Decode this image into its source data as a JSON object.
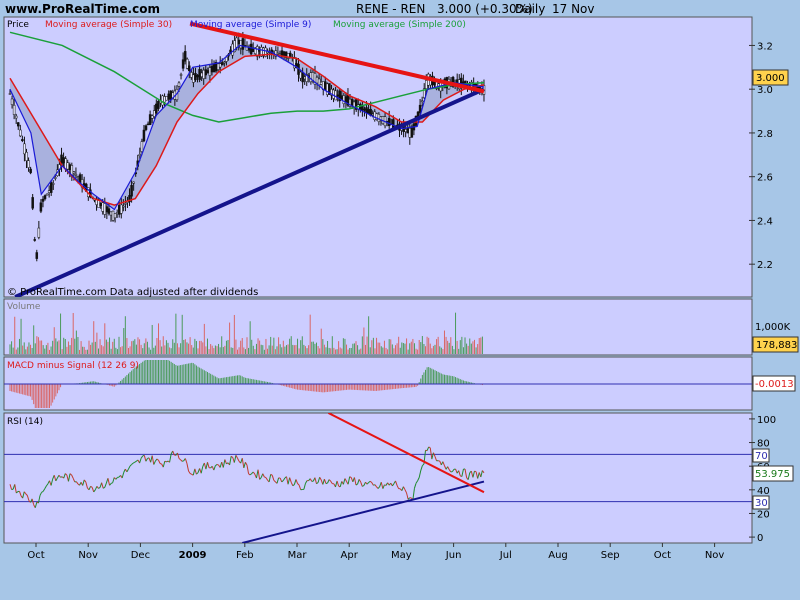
{
  "header": {
    "site": "www.ProRealTime.com",
    "symbol": "RENE - REN",
    "quote": "3.000 (+0.30%)",
    "period": "Daily",
    "date": "17 Nov"
  },
  "colors": {
    "panel_bg": "#cccdff",
    "page_bg": "#a7c6e7",
    "ma30": "#dd1a1a",
    "ma9": "#1a1ad6",
    "ma200": "#1aa03a",
    "uptrend": "#14148c",
    "downtrend": "#e61414"
  },
  "chart_data": [
    {
      "type": "candlestick",
      "panel": "Price",
      "legend": [
        {
          "label": "Price",
          "color": "#000000"
        },
        {
          "label": "Moving average (Simple 30)",
          "color": "#dd1a1a"
        },
        {
          "label": "Moving average (Simple 9)",
          "color": "#1a1ad6"
        },
        {
          "label": "Moving average (Simple 200)",
          "color": "#1aa03a"
        }
      ],
      "note": "© ProRealTime.com  Data adjusted after dividends",
      "last_value": "3.000",
      "ylim": [
        2.05,
        3.33
      ],
      "y_ticks": [
        "3.2",
        "3.0",
        "2.8",
        "2.6",
        "2.4",
        "2.2"
      ],
      "y_tick_values": [
        3.2,
        3.0,
        2.8,
        2.6,
        2.4,
        2.2
      ],
      "x_labels": [
        "Oct",
        "Nov",
        "Dec",
        "2009",
        "Feb",
        "Mar",
        "Apr",
        "May",
        "Jun",
        "Jul",
        "Aug",
        "Sep",
        "Oct",
        "Nov"
      ],
      "close": [
        {
          "t": 0,
          "v": 2.98
        },
        {
          "t": 0.2,
          "v": 2.8
        },
        {
          "t": 0.4,
          "v": 2.62
        },
        {
          "t": 0.5,
          "v": 2.2
        },
        {
          "t": 0.6,
          "v": 2.48
        },
        {
          "t": 0.8,
          "v": 2.55
        },
        {
          "t": 1.0,
          "v": 2.68
        },
        {
          "t": 1.3,
          "v": 2.6
        },
        {
          "t": 1.6,
          "v": 2.5
        },
        {
          "t": 2.0,
          "v": 2.42
        },
        {
          "t": 2.3,
          "v": 2.5
        },
        {
          "t": 2.6,
          "v": 2.82
        },
        {
          "t": 2.9,
          "v": 2.95
        },
        {
          "t": 3.2,
          "v": 2.98
        },
        {
          "t": 3.35,
          "v": 3.15
        },
        {
          "t": 3.5,
          "v": 3.05
        },
        {
          "t": 3.8,
          "v": 3.08
        },
        {
          "t": 4.1,
          "v": 3.12
        },
        {
          "t": 4.35,
          "v": 3.22
        },
        {
          "t": 4.6,
          "v": 3.18
        },
        {
          "t": 5.0,
          "v": 3.17
        },
        {
          "t": 5.4,
          "v": 3.15
        },
        {
          "t": 5.6,
          "v": 3.05
        },
        {
          "t": 5.8,
          "v": 3.06
        },
        {
          "t": 6.2,
          "v": 2.98
        },
        {
          "t": 6.6,
          "v": 2.93
        },
        {
          "t": 7.0,
          "v": 2.88
        },
        {
          "t": 7.4,
          "v": 2.83
        },
        {
          "t": 7.7,
          "v": 2.8
        },
        {
          "t": 7.85,
          "v": 2.9
        },
        {
          "t": 8.0,
          "v": 3.05
        },
        {
          "t": 8.2,
          "v": 3.02
        },
        {
          "t": 8.5,
          "v": 3.03
        },
        {
          "t": 8.8,
          "v": 3.02
        },
        {
          "t": 9.08,
          "v": 3.0
        }
      ],
      "ma30": [
        {
          "t": 0,
          "v": 3.05
        },
        {
          "t": 0.5,
          "v": 2.85
        },
        {
          "t": 1.0,
          "v": 2.65
        },
        {
          "t": 1.6,
          "v": 2.5
        },
        {
          "t": 2.0,
          "v": 2.47
        },
        {
          "t": 2.4,
          "v": 2.5
        },
        {
          "t": 2.8,
          "v": 2.65
        },
        {
          "t": 3.2,
          "v": 2.85
        },
        {
          "t": 3.6,
          "v": 2.98
        },
        {
          "t": 4.0,
          "v": 3.08
        },
        {
          "t": 4.5,
          "v": 3.15
        },
        {
          "t": 5.0,
          "v": 3.16
        },
        {
          "t": 5.5,
          "v": 3.14
        },
        {
          "t": 6.0,
          "v": 3.06
        },
        {
          "t": 6.5,
          "v": 2.97
        },
        {
          "t": 7.0,
          "v": 2.92
        },
        {
          "t": 7.5,
          "v": 2.85
        },
        {
          "t": 7.9,
          "v": 2.85
        },
        {
          "t": 8.3,
          "v": 2.95
        },
        {
          "t": 8.7,
          "v": 3.0
        },
        {
          "t": 9.08,
          "v": 3.02
        }
      ],
      "ma9": [
        {
          "t": 0,
          "v": 3.0
        },
        {
          "t": 0.4,
          "v": 2.8
        },
        {
          "t": 0.6,
          "v": 2.52
        },
        {
          "t": 1.0,
          "v": 2.65
        },
        {
          "t": 1.3,
          "v": 2.58
        },
        {
          "t": 1.6,
          "v": 2.52
        },
        {
          "t": 2.0,
          "v": 2.45
        },
        {
          "t": 2.4,
          "v": 2.62
        },
        {
          "t": 2.8,
          "v": 2.88
        },
        {
          "t": 3.2,
          "v": 2.98
        },
        {
          "t": 3.5,
          "v": 3.1
        },
        {
          "t": 4.0,
          "v": 3.12
        },
        {
          "t": 4.4,
          "v": 3.2
        },
        {
          "t": 5.0,
          "v": 3.17
        },
        {
          "t": 5.5,
          "v": 3.1
        },
        {
          "t": 6.0,
          "v": 3.0
        },
        {
          "t": 6.5,
          "v": 2.93
        },
        {
          "t": 7.0,
          "v": 2.87
        },
        {
          "t": 7.5,
          "v": 2.82
        },
        {
          "t": 7.8,
          "v": 2.83
        },
        {
          "t": 8.0,
          "v": 3.0
        },
        {
          "t": 8.5,
          "v": 3.03
        },
        {
          "t": 9.08,
          "v": 3.01
        }
      ],
      "ma200": [
        {
          "t": 0,
          "v": 3.26
        },
        {
          "t": 1.0,
          "v": 3.2
        },
        {
          "t": 2.0,
          "v": 3.08
        },
        {
          "t": 3.0,
          "v": 2.93
        },
        {
          "t": 3.5,
          "v": 2.88
        },
        {
          "t": 4.0,
          "v": 2.85
        },
        {
          "t": 4.5,
          "v": 2.87
        },
        {
          "t": 5.0,
          "v": 2.89
        },
        {
          "t": 5.5,
          "v": 2.9
        },
        {
          "t": 6.0,
          "v": 2.9
        },
        {
          "t": 6.5,
          "v": 2.91
        },
        {
          "t": 7.0,
          "v": 2.94
        },
        {
          "t": 7.5,
          "v": 2.97
        },
        {
          "t": 8.0,
          "v": 3.0
        },
        {
          "t": 8.5,
          "v": 3.02
        },
        {
          "t": 9.08,
          "v": 3.03
        }
      ],
      "trendlines": [
        {
          "name": "support",
          "from": {
            "t": 0.1,
            "v": 2.05
          },
          "to": {
            "t": 9.08,
            "v": 3.0
          }
        },
        {
          "name": "resistance",
          "from": {
            "t": 3.45,
            "v": 3.3
          },
          "to": {
            "t": 9.08,
            "v": 2.99
          }
        }
      ]
    },
    {
      "type": "bar",
      "panel": "Volume",
      "title": "Volume",
      "y_ticks": [
        "1,000K"
      ],
      "last_value": "178,883"
    },
    {
      "type": "histogram",
      "panel": "MACD",
      "title": "MACD minus Signal (12 26 9)",
      "last_value": "-0.0013"
    },
    {
      "type": "line",
      "panel": "RSI",
      "title": "RSI (14)",
      "ylim": [
        -5,
        105
      ],
      "y_ticks": [
        "100",
        "80",
        "60",
        "40",
        "20",
        "0"
      ],
      "y_tick_values": [
        100,
        80,
        60,
        40,
        20,
        0
      ],
      "levels": [
        "70",
        "30"
      ],
      "level_values": [
        70,
        30
      ],
      "last_value": "53.975",
      "values": [
        {
          "t": 0,
          "v": 45
        },
        {
          "t": 0.3,
          "v": 35
        },
        {
          "t": 0.5,
          "v": 28
        },
        {
          "t": 0.7,
          "v": 45
        },
        {
          "t": 1.0,
          "v": 52
        },
        {
          "t": 1.3,
          "v": 48
        },
        {
          "t": 1.6,
          "v": 42
        },
        {
          "t": 2.0,
          "v": 48
        },
        {
          "t": 2.3,
          "v": 58
        },
        {
          "t": 2.6,
          "v": 68
        },
        {
          "t": 2.9,
          "v": 62
        },
        {
          "t": 3.2,
          "v": 72
        },
        {
          "t": 3.5,
          "v": 55
        },
        {
          "t": 3.8,
          "v": 60
        },
        {
          "t": 4.1,
          "v": 62
        },
        {
          "t": 4.35,
          "v": 68
        },
        {
          "t": 4.6,
          "v": 55
        },
        {
          "t": 5.0,
          "v": 50
        },
        {
          "t": 5.4,
          "v": 48
        },
        {
          "t": 5.6,
          "v": 40
        },
        {
          "t": 5.8,
          "v": 50
        },
        {
          "t": 6.2,
          "v": 45
        },
        {
          "t": 6.6,
          "v": 48
        },
        {
          "t": 7.0,
          "v": 42
        },
        {
          "t": 7.4,
          "v": 45
        },
        {
          "t": 7.7,
          "v": 32
        },
        {
          "t": 7.85,
          "v": 55
        },
        {
          "t": 8.0,
          "v": 75
        },
        {
          "t": 8.2,
          "v": 62
        },
        {
          "t": 8.5,
          "v": 58
        },
        {
          "t": 8.8,
          "v": 52
        },
        {
          "t": 9.08,
          "v": 54
        }
      ],
      "trendlines": [
        {
          "name": "support",
          "from": {
            "t": 4.45,
            "v": -5
          },
          "to": {
            "t": 9.08,
            "v": 47
          }
        },
        {
          "name": "resistance",
          "from": {
            "t": 6.1,
            "v": 105
          },
          "to": {
            "t": 9.08,
            "v": 38
          }
        }
      ]
    }
  ]
}
